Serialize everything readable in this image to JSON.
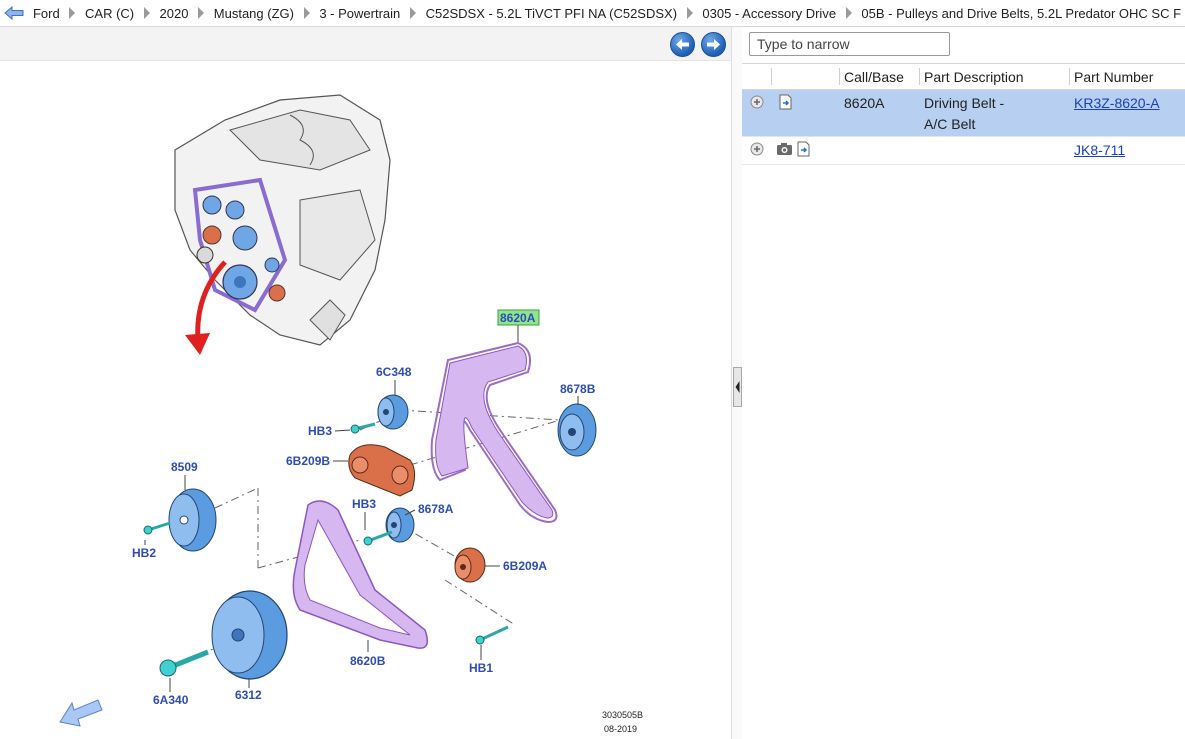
{
  "breadcrumb": [
    {
      "label": "Ford"
    },
    {
      "label": "CAR (C)"
    },
    {
      "label": "2020"
    },
    {
      "label": "Mustang (ZG)"
    },
    {
      "label": "3 - Powertrain"
    },
    {
      "label": "C52SDSX - 5.2L TiVCT PFI NA (C52SDSX)"
    },
    {
      "label": "0305 - Accessory Drive"
    },
    {
      "label": "05B - Pulleys and Drive Belts, 5.2L Predator OHC SC F"
    }
  ],
  "filter": {
    "placeholder": "Type to narrow"
  },
  "grid": {
    "columns": [
      "Call/Base",
      "Part Description",
      "Part Number"
    ],
    "rows": [
      {
        "call": "8620A",
        "desc_line1": "Driving Belt -",
        "desc_line2": "A/C Belt",
        "part_number": "KR3Z-8620-A",
        "selected": true
      },
      {
        "call": "",
        "desc_line1": "",
        "desc_line2": "",
        "part_number": "JK8-711",
        "selected": false
      }
    ]
  },
  "diagram": {
    "labels": {
      "l8620A": "8620A",
      "l6C348": "6C348",
      "l8678B": "8678B",
      "lHB3a": "HB3",
      "l6B209B": "6B209B",
      "l8509": "8509",
      "lHB3b": "HB3",
      "l8678A": "8678A",
      "lHB2": "HB2",
      "l6B209A": "6B209A",
      "l8620B": "8620B",
      "lHB1": "HB1",
      "l6A340": "6A340",
      "l6312": "6312"
    },
    "stamp_code": "3030505B",
    "stamp_date": "08-2019"
  },
  "colors": {
    "accent": "#1f5fb5",
    "selected_row": "#b7cff0",
    "belt": "#c9a0e0",
    "pulley_blue": "#5b9be0",
    "tensioner_orange": "#d9704a",
    "callout_green": "#7ee07e",
    "link": "#1a3fbf"
  }
}
